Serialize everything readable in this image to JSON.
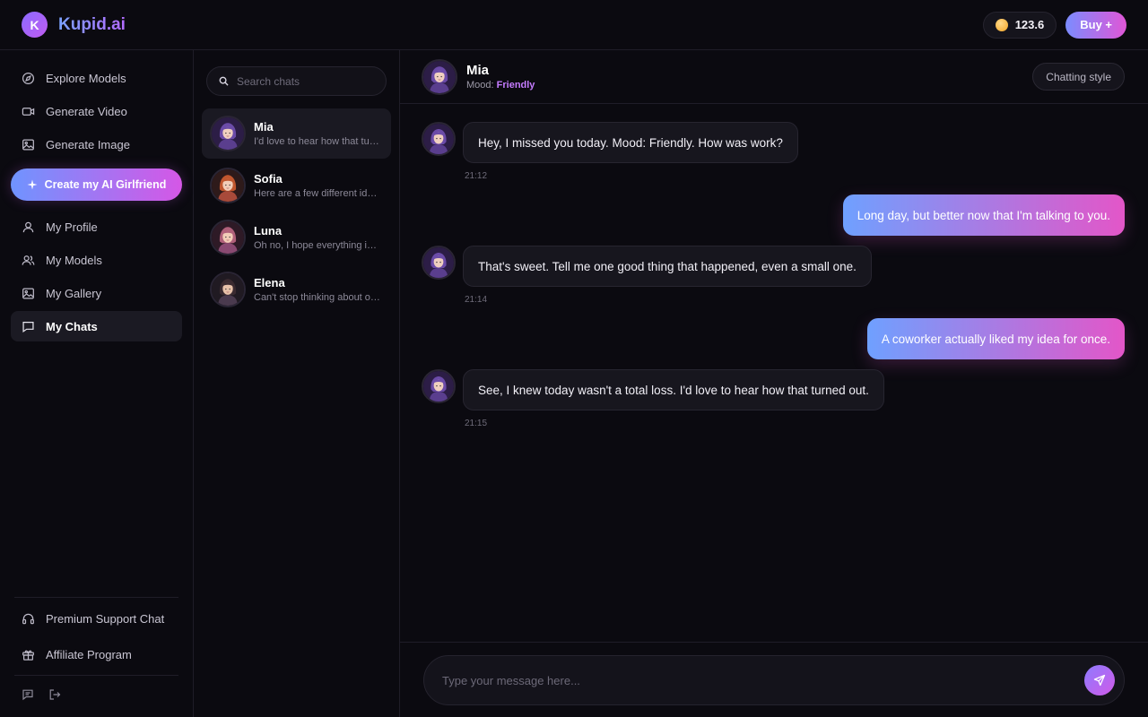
{
  "app": {
    "logo_letter": "K",
    "name": "Kupid.ai"
  },
  "topbar": {
    "credits": "123.6",
    "buy_label": "Buy +"
  },
  "sidebar": {
    "items_top": [
      {
        "label": "Explore Models",
        "icon": "compass-icon"
      },
      {
        "label": "Generate Video",
        "icon": "video-camera-icon"
      },
      {
        "label": "Generate Image",
        "icon": "image-icon"
      }
    ],
    "create_label": "Create my AI Girlfriend",
    "items_mid": [
      {
        "label": "My Profile",
        "icon": "user-icon"
      },
      {
        "label": "My Models",
        "icon": "users-icon"
      },
      {
        "label": "My Gallery",
        "icon": "gallery-icon"
      },
      {
        "label": "My Chats",
        "icon": "chat-icon",
        "active": true
      }
    ],
    "items_bottom": [
      {
        "label": "Premium Support Chat",
        "icon": "headphones-icon"
      },
      {
        "label": "Affiliate Program",
        "icon": "gift-icon"
      }
    ]
  },
  "chatlist": {
    "search_placeholder": "Search chats",
    "chats": [
      {
        "name": "Mia",
        "preview": "I'd love to hear how that turned out.",
        "active": true
      },
      {
        "name": "Sofia",
        "preview": "Here are a few different ideas for you."
      },
      {
        "name": "Luna",
        "preview": "Oh no, I hope everything is okay."
      },
      {
        "name": "Elena",
        "preview": "Can't stop thinking about our talk."
      }
    ]
  },
  "chat": {
    "name": "Mia",
    "mood_label": "Mood:",
    "mood": "Friendly",
    "style_button": "Chatting style",
    "messages": [
      {
        "from": "ai",
        "text": "Hey, I missed you today. Mood: Friendly. How was work?",
        "time": "21:12"
      },
      {
        "from": "me",
        "text": "Long day, but better now that I'm talking to you."
      },
      {
        "from": "ai",
        "text": "That's sweet. Tell me one good thing that happened, even a small one.",
        "time": "21:14"
      },
      {
        "from": "me",
        "text": "A coworker actually liked my idea for once."
      },
      {
        "from": "ai",
        "text": "See, I knew today wasn't a total loss. I'd love to hear how that turned out.",
        "time": "21:15"
      }
    ],
    "input_placeholder": "Type your message here..."
  },
  "colors": {
    "accent_start": "#6fa0ff",
    "accent_end": "#e356c8",
    "background": "#0b0a10"
  }
}
